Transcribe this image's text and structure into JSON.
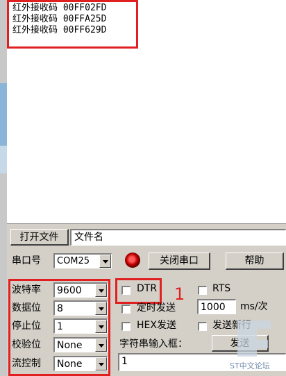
{
  "receive": {
    "lines": [
      "红外接收码 00FF02FD",
      "红外接收码 00FFA25D",
      "红外接收码 00FF629D"
    ]
  },
  "file": {
    "open_label": "打开文件",
    "filename": "文件名"
  },
  "port": {
    "label": "串口号",
    "value": "COM25",
    "close_label": "关闭串口",
    "help_label": "帮助"
  },
  "settings": {
    "baud_label": "波特率",
    "baud": "9600",
    "databits_label": "数据位",
    "databits": "8",
    "stopbits_label": "停止位",
    "stopbits": "1",
    "parity_label": "校验位",
    "parity": "None",
    "flow_label": "流控制",
    "flow": "None"
  },
  "options": {
    "dtr_label": "DTR",
    "rts_label": "RTS",
    "timed_send_label": "定时发送",
    "interval": "1000",
    "interval_unit": "ms/次",
    "hex_send_label": "HEX发送",
    "newline_label": "发送新行",
    "input_label": "字符串输入框：",
    "send_label": "发送",
    "input_value": "1"
  },
  "annotation": {
    "marker": "1"
  },
  "watermark": {
    "text": "ST中文论坛"
  },
  "colors": {
    "highlight": "#e02020",
    "led": "#c00000"
  }
}
